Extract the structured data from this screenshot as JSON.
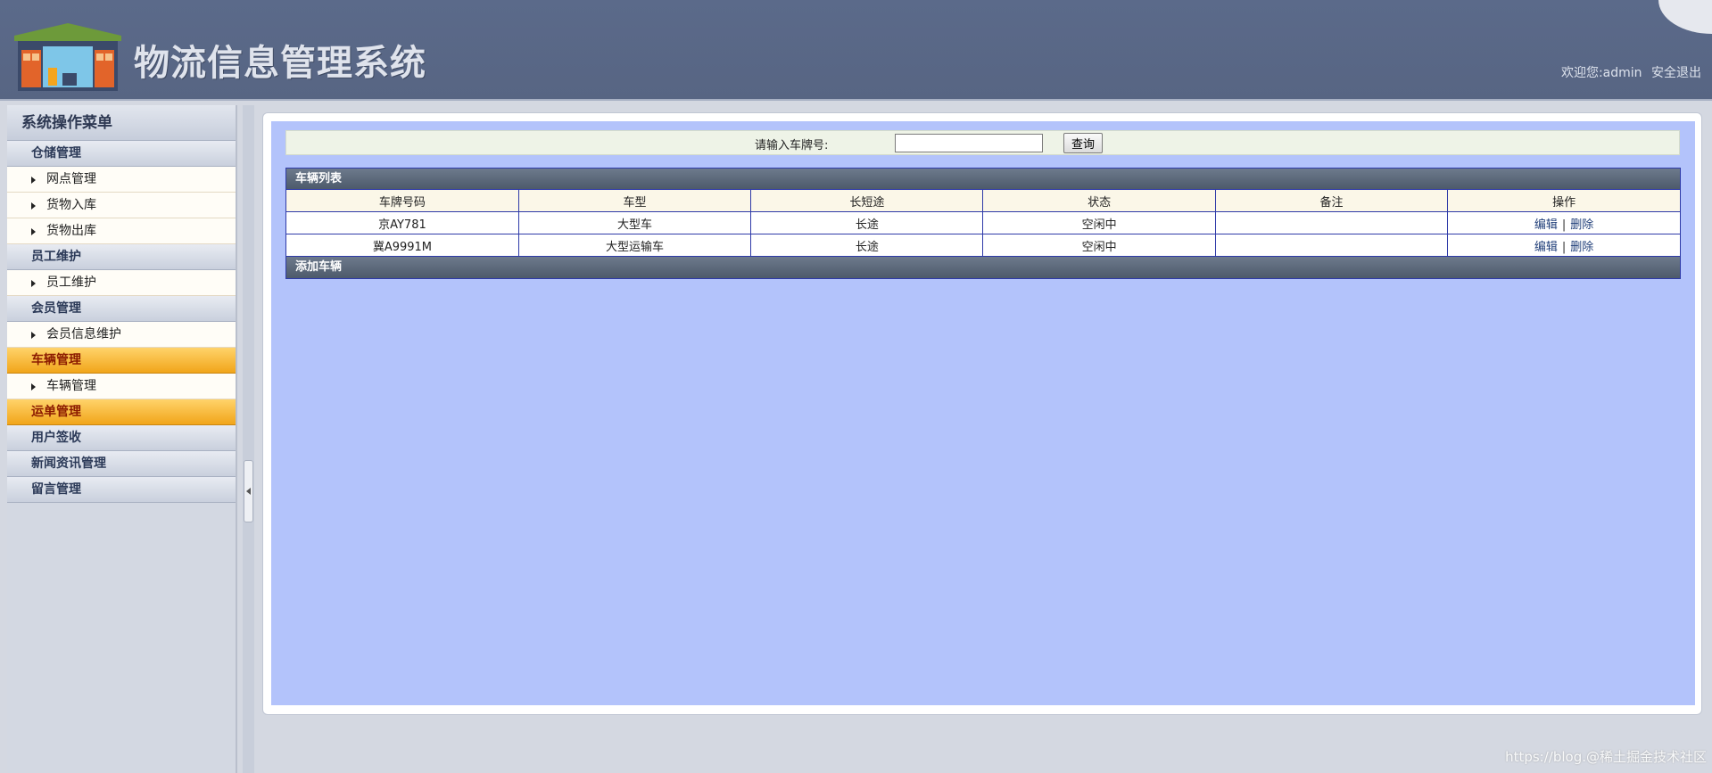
{
  "header": {
    "title": "物流信息管理系统",
    "welcome": "欢迎您:admin",
    "logout": "安全退出"
  },
  "sidebar": {
    "title": "系统操作菜单",
    "groups": [
      {
        "label": "仓储管理",
        "items": [
          "网点管理",
          "货物入库",
          "货物出库"
        ]
      },
      {
        "label": "员工维护",
        "items": [
          "员工维护"
        ]
      },
      {
        "label": "会员管理",
        "items": [
          "会员信息维护"
        ]
      },
      {
        "label": "车辆管理",
        "items": [
          "车辆管理"
        ],
        "active": true
      },
      {
        "label": "运单管理",
        "items": [],
        "active": true
      },
      {
        "label": "用户签收",
        "items": []
      },
      {
        "label": "新闻资讯管理",
        "items": []
      },
      {
        "label": "留言管理",
        "items": []
      }
    ]
  },
  "search": {
    "label": "请输入车牌号:",
    "value": "",
    "button": "查询"
  },
  "vehicle_list": {
    "title": "车辆列表",
    "columns": [
      "车牌号码",
      "车型",
      "长短途",
      "状态",
      "备注",
      "操作"
    ],
    "rows": [
      {
        "plate": "京AY781",
        "type": "大型车",
        "distance": "长途",
        "status": "空闲中",
        "note": ""
      },
      {
        "plate": "冀A9991M",
        "type": "大型运输车",
        "distance": "长途",
        "status": "空闲中",
        "note": ""
      }
    ],
    "edit_label": "编辑",
    "separator": "|",
    "delete_label": "删除",
    "add_label": "添加车辆"
  },
  "watermark": "https://blog.@稀土掘金技术社区",
  "colors": {
    "header_bg": "#5b6a8a",
    "active_menu": "#f4b02a",
    "content_bg": "#b3c3fb",
    "table_border": "#2e3aa8"
  }
}
